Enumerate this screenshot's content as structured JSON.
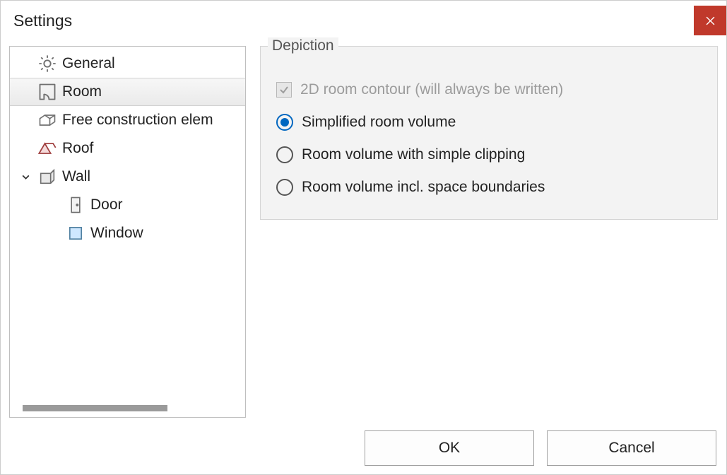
{
  "window": {
    "title": "Settings"
  },
  "sidebar": {
    "items": [
      {
        "label": "General"
      },
      {
        "label": "Room"
      },
      {
        "label": "Free construction elem"
      },
      {
        "label": "Roof"
      },
      {
        "label": "Wall"
      },
      {
        "label": "Door"
      },
      {
        "label": "Window"
      }
    ]
  },
  "panel": {
    "group_title": "Depiction",
    "checkbox_label": "2D room contour (will always be written)",
    "radio1_label": "Simplified room volume",
    "radio2_label": "Room volume with simple clipping",
    "radio3_label": "Room volume incl. space boundaries"
  },
  "buttons": {
    "ok": "OK",
    "cancel": "Cancel"
  }
}
